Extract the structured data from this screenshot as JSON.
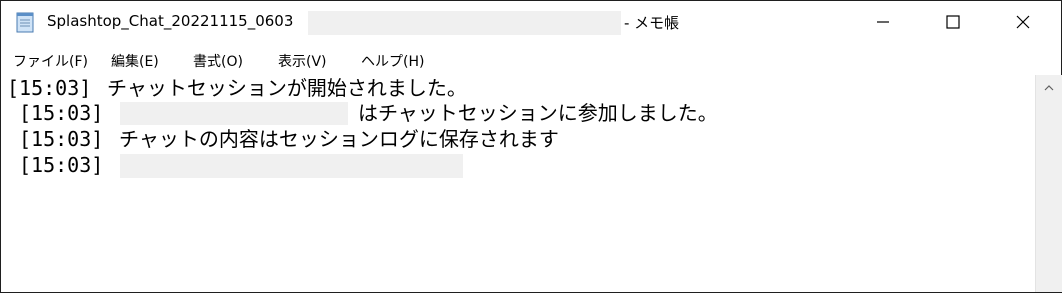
{
  "window": {
    "title_prefix": "Splashtop_Chat_20221115_0603",
    "title_suffix": "- メモ帳"
  },
  "menu": {
    "items": [
      "ファイル(F)",
      "編集(E)",
      "書式(O)",
      "表示(V)",
      "ヘルプ(H)"
    ]
  },
  "content": {
    "lines": [
      {
        "time": "[15:03]",
        "text": " チャットセッションが開始されました。"
      },
      {
        "time": "[15:03]",
        "text": "はチャットセッションに参加しました。"
      },
      {
        "time": "[15:03]",
        "text": " チャットの内容はセッションログに保存されます"
      },
      {
        "time": "[15:03]",
        "text": ""
      }
    ]
  },
  "icons": {
    "app": "notepad-icon",
    "minimize": "minimize-icon",
    "maximize": "maximize-icon",
    "close": "close-icon",
    "scroll_up": "chevron-up-icon"
  }
}
